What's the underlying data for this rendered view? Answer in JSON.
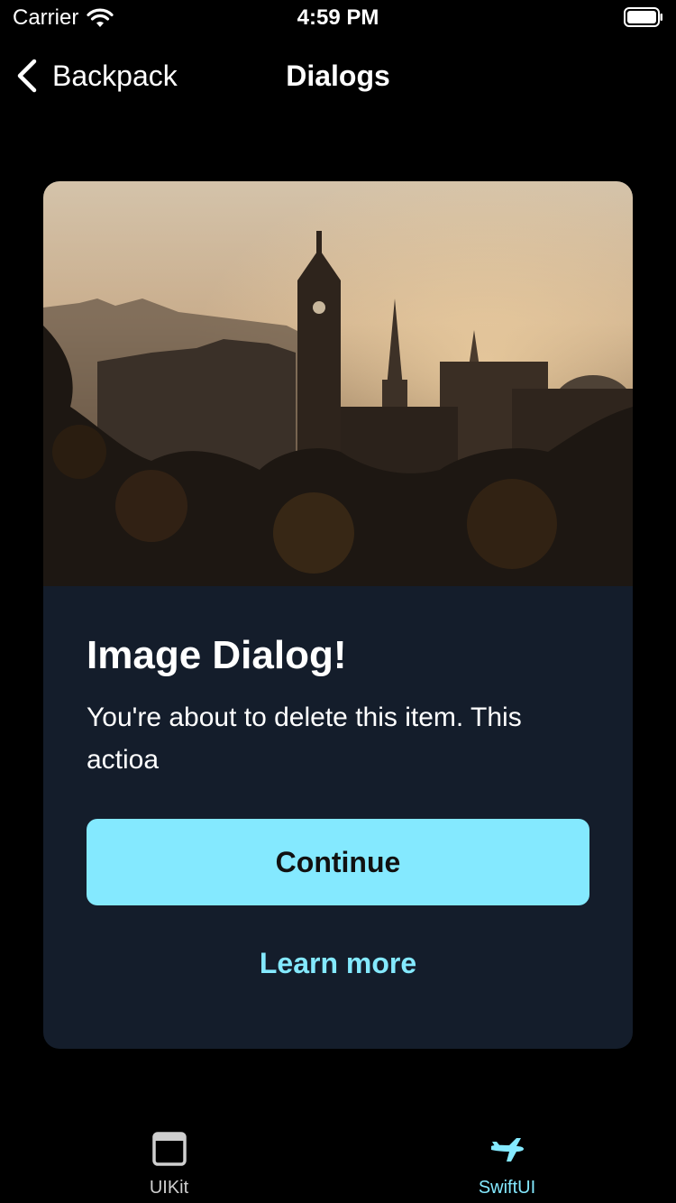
{
  "status_bar": {
    "carrier": "Carrier",
    "time": "4:59 PM",
    "icons": [
      "wifi-icon",
      "battery-icon"
    ]
  },
  "nav": {
    "back_label": "Backpack",
    "title": "Dialogs",
    "back_icon": "chevron-left-icon"
  },
  "dialog": {
    "title": "Image Dialog!",
    "text": "You're about to delete this item. This actioa",
    "primary_button": "Continue",
    "secondary_button": "Learn more"
  },
  "tabs": [
    {
      "label": "UIKit",
      "icon": "window-icon",
      "selected": false
    },
    {
      "label": "SwiftUI",
      "icon": "plane-icon",
      "selected": true
    }
  ],
  "colors": {
    "background": "#000000",
    "dialog_background": "#141d2b",
    "accent": "#84e9ff",
    "primary_button_text": "#111111"
  }
}
